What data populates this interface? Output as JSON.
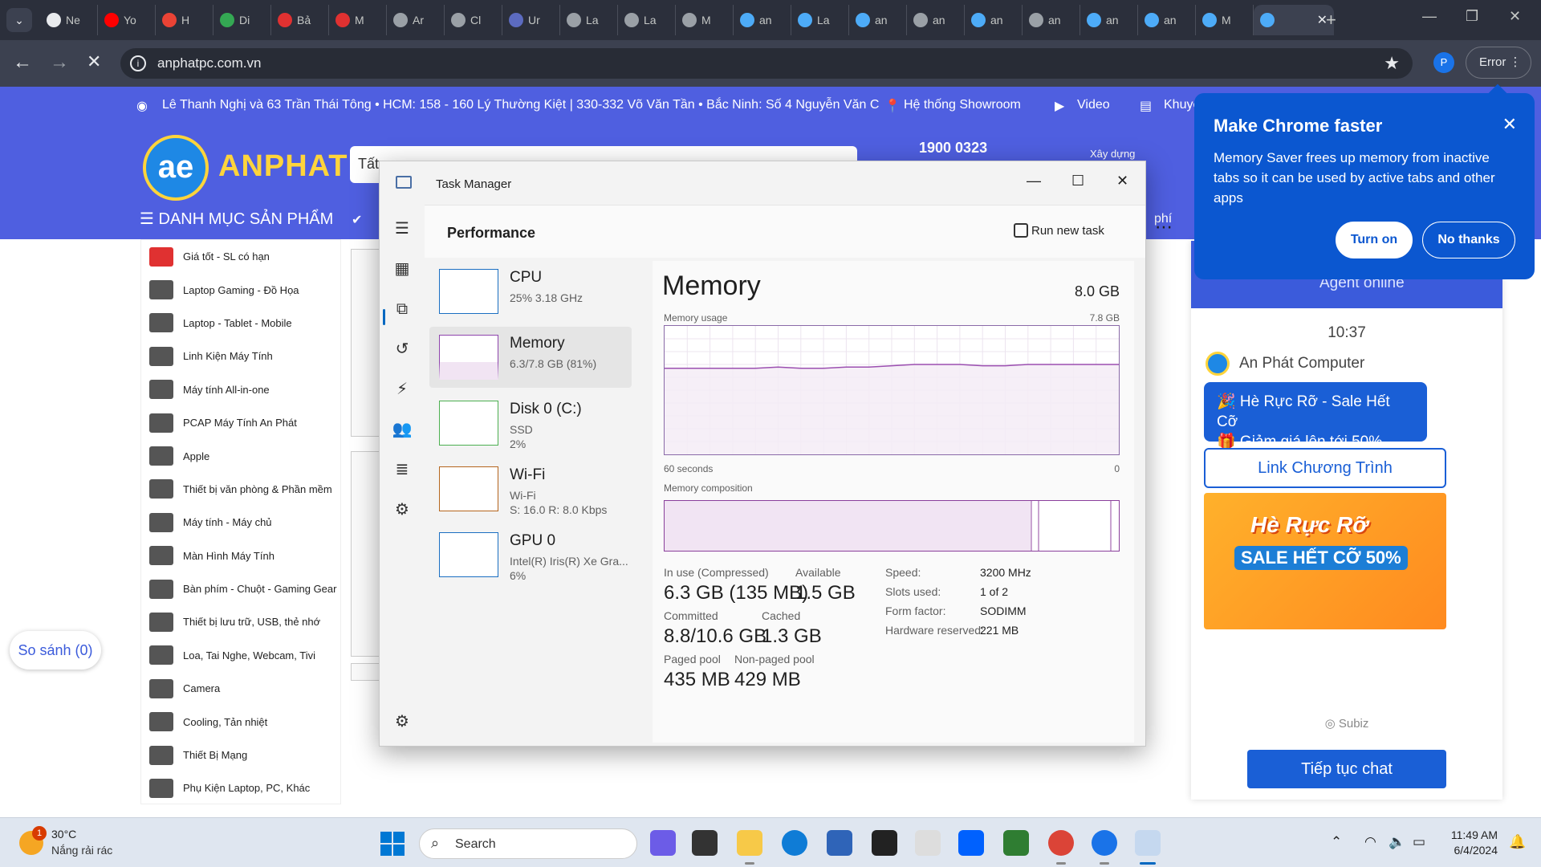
{
  "browser": {
    "tabs": [
      {
        "label": "Ne",
        "color": "#e8eaed"
      },
      {
        "label": "Yo",
        "color": "#ff0000"
      },
      {
        "label": "H",
        "color": "#ea4335"
      },
      {
        "label": "Di",
        "color": "#34a853"
      },
      {
        "label": "Bả",
        "color": "#e03131"
      },
      {
        "label": "M",
        "color": "#e03131"
      },
      {
        "label": "Ar",
        "color": "#9aa0a6"
      },
      {
        "label": "Cl",
        "color": "#9aa0a6"
      },
      {
        "label": "Ur",
        "color": "#5c6bc0"
      },
      {
        "label": "La",
        "color": "#9aa0a6"
      },
      {
        "label": "La",
        "color": "#9aa0a6"
      },
      {
        "label": "M",
        "color": "#9aa0a6"
      },
      {
        "label": "an",
        "color": "#4dabf7"
      },
      {
        "label": "La",
        "color": "#4dabf7"
      },
      {
        "label": "an",
        "color": "#4dabf7"
      },
      {
        "label": "an",
        "color": "#9aa0a6"
      },
      {
        "label": "an",
        "color": "#4dabf7"
      },
      {
        "label": "an",
        "color": "#9aa0a6"
      },
      {
        "label": "an",
        "color": "#4dabf7"
      },
      {
        "label": "an",
        "color": "#4dabf7"
      },
      {
        "label": "M",
        "color": "#4dabf7"
      }
    ],
    "url": "anphatpc.com.vn",
    "profile_initial": "P",
    "error_label": "Error"
  },
  "site": {
    "infobar_address": "Lê Thanh Nghị và 63 Trần Thái Tông • HCM: 158 - 160 Lý Thường Kiệt | 330-332 Võ Văn Tần • Bắc Ninh: Số 4 Nguyễn Văn C",
    "infobar_showroom": "Hệ thống Showroom",
    "infobar_video": "Video",
    "infobar_promo": "Khuyế",
    "logo_text": "ANPHAT",
    "search_text": "Tất",
    "hotline": "1900 0323",
    "xay_dung": "Xây dựng",
    "danh_muc": "DANH MỤC SẢN PHẨM",
    "nav_fee": "phí",
    "menu": [
      "Giá tốt - SL có hạn",
      "Laptop Gaming - Đồ Họa",
      "Laptop - Tablet - Mobile",
      "Linh Kiện Máy Tính",
      "Máy tính All-in-one",
      "PCAP Máy Tính An Phát",
      "Apple",
      "Thiết bị văn phòng & Phần mềm",
      "Máy tính - Máy chủ",
      "Màn Hình Máy Tính",
      "Bàn phím - Chuột - Gaming Gear",
      "Thiết bị lưu trữ, USB, thẻ nhớ",
      "Loa, Tai Nghe, Webcam, Tivi",
      "Camera",
      "Cooling, Tản nhiệt",
      "Thiết Bị Mạng",
      "Phụ Kiện Laptop, PC, Khác"
    ],
    "so_sanh": "So sánh (0)"
  },
  "chat": {
    "agent_status": "Agent online",
    "time": "10:37",
    "company": "An Phát Computer",
    "bubble_line1": "🎉 Hè Rực Rỡ - Sale Hết Cỡ",
    "bubble_line2": "🎁 Giảm giá lên tới 50%",
    "link_button": "Link Chương Trình",
    "promo_title": "Hè Rực Rỡ",
    "promo_sale": "SALE HẾT CỠ",
    "promo_pct": "50%",
    "powered": "Subiz",
    "continue_button": "Tiếp tục chat"
  },
  "popup": {
    "title": "Make Chrome faster",
    "body": "Memory Saver frees up memory from inactive tabs so it can be used by active tabs and other apps",
    "turn_on": "Turn on",
    "no_thanks": "No thanks"
  },
  "taskmanager": {
    "title": "Task Manager",
    "section": "Performance",
    "run_new_task": "Run new task",
    "resources": [
      {
        "name": "CPU",
        "line1": "25%  3.18 GHz",
        "line2": "",
        "color": "#1b6fc2"
      },
      {
        "name": "Memory",
        "line1": "6.3/7.8 GB (81%)",
        "line2": "",
        "color": "#8e44ad"
      },
      {
        "name": "Disk 0 (C:)",
        "line1": "SSD",
        "line2": "2%",
        "color": "#4caf50"
      },
      {
        "name": "Wi-Fi",
        "line1": "Wi-Fi",
        "line2": "S: 16.0  R: 8.0 Kbps",
        "color": "#b5651d"
      },
      {
        "name": "GPU 0",
        "line1": "Intel(R) Iris(R) Xe Gra...",
        "line2": "6%",
        "color": "#1b6fc2"
      }
    ],
    "memory": {
      "title": "Memory",
      "total": "8.0 GB",
      "usage_label": "Memory usage",
      "usage_max": "7.8 GB",
      "axis_left": "60 seconds",
      "axis_right": "0",
      "composition_label": "Memory composition",
      "usage_fraction": [
        0.67,
        0.67,
        0.67,
        0.67,
        0.67,
        0.68,
        0.67,
        0.67,
        0.68,
        0.68,
        0.69,
        0.7,
        0.7,
        0.7,
        0.69,
        0.69,
        0.7,
        0.7,
        0.7,
        0.7,
        0.7
      ],
      "composition": {
        "in_use_fraction": 0.81,
        "modified_fraction": 0.825,
        "standby_fraction": 0.985
      },
      "stats": {
        "in_use_label": "In use (Compressed)",
        "in_use_value": "6.3 GB (135 MB)",
        "available_label": "Available",
        "available_value": "1.5 GB",
        "committed_label": "Committed",
        "committed_value": "8.8/10.6 GB",
        "cached_label": "Cached",
        "cached_value": "1.3 GB",
        "paged_label": "Paged pool",
        "paged_value": "435 MB",
        "nonpaged_label": "Non-paged pool",
        "nonpaged_value": "429 MB"
      },
      "specs": {
        "speed_label": "Speed:",
        "speed_value": "3200 MHz",
        "slots_label": "Slots used:",
        "slots_value": "1 of 2",
        "form_label": "Form factor:",
        "form_value": "SODIMM",
        "hw_label": "Hardware reserved:",
        "hw_value": "221 MB"
      }
    }
  },
  "taskbar": {
    "temp": "30°C",
    "weather": "Nắng rải rác",
    "weather_badge": "1",
    "search": "Search",
    "time": "11:49 AM",
    "date": "6/4/2024"
  }
}
